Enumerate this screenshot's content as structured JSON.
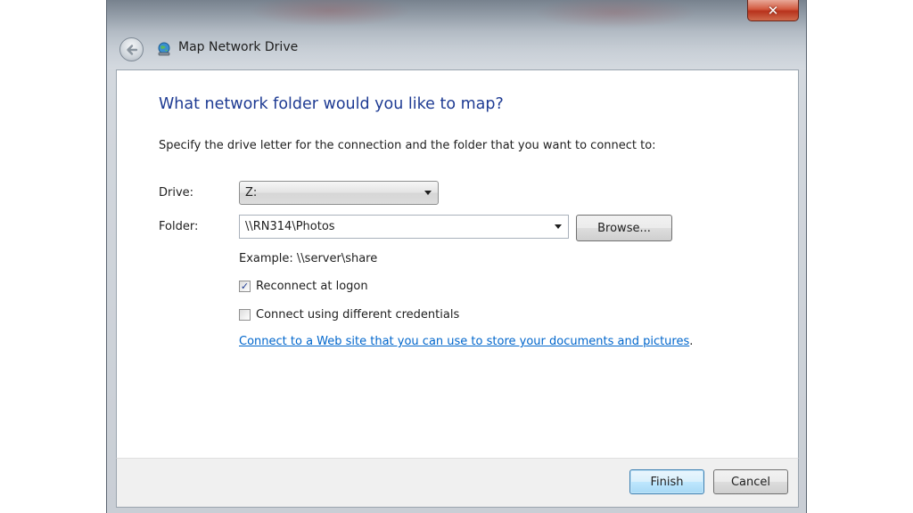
{
  "window": {
    "title": "Map Network Drive",
    "close_glyph": "✕",
    "back_icon": "back-arrow-icon",
    "title_icon": "network-drive-icon"
  },
  "main": {
    "heading": "What network folder would you like to map?",
    "instructions": "Specify the drive letter for the connection and the folder that you want to connect to:",
    "drive_label": "Drive:",
    "drive_value": "Z:",
    "folder_label": "Folder:",
    "folder_value": "\\\\RN314\\Photos",
    "browse_label": "Browse...",
    "example": "Example: \\\\server\\share",
    "reconnect_label": "Reconnect at logon",
    "reconnect_checked": true,
    "credentials_label": "Connect using different credentials",
    "credentials_checked": false,
    "link_text": "Connect to a Web site that you can use to store your documents and pictures",
    "link_suffix": "."
  },
  "footer": {
    "finish_label": "Finish",
    "cancel_label": "Cancel"
  },
  "colors": {
    "heading": "#1e3b93",
    "link": "#0066cc",
    "close_button": "#c7432a"
  }
}
